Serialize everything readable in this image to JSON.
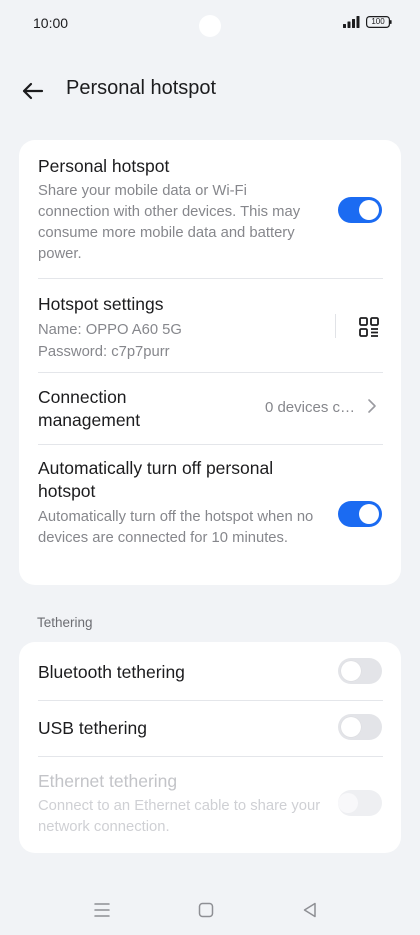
{
  "status_bar": {
    "time": "10:00",
    "battery": "100",
    "signal_icon": "signal-bars-icon",
    "battery_icon": "battery-icon"
  },
  "header": {
    "back_icon": "arrow-left-icon",
    "title": "Personal hotspot"
  },
  "colors": {
    "accent": "#1b6bf2",
    "background": "#f1f3f6",
    "card": "#ffffff"
  },
  "main_settings": {
    "personal_hotspot": {
      "title": "Personal hotspot",
      "description": "Share your mobile data or Wi-Fi connection with other devices. This may consume more mobile data and battery power.",
      "enabled": true
    },
    "hotspot_settings": {
      "title": "Hotspot settings",
      "name_line": "Name: OPPO A60 5G",
      "password_line": "Password: c7p7purr",
      "qr_icon": "qr-code-icon"
    },
    "connection_management": {
      "title": "Connection management",
      "value": "0 devices c…",
      "chevron_icon": "chevron-right-icon"
    },
    "auto_turn_off": {
      "title": "Automatically turn off personal hotspot",
      "description": "Automatically turn off the hotspot when no devices are connected for 10 minutes.",
      "enabled": true
    }
  },
  "tethering": {
    "section_label": "Tethering",
    "bluetooth": {
      "title": "Bluetooth tethering",
      "enabled": false
    },
    "usb": {
      "title": "USB tethering",
      "enabled": false
    },
    "ethernet": {
      "title": "Ethernet tethering",
      "description": "Connect to an Ethernet cable to share your network connection.",
      "enabled": false,
      "disabled": true
    }
  },
  "nav_bar": {
    "menu_icon": "menu-icon",
    "home_icon": "home-square-icon",
    "back_icon": "back-triangle-icon"
  }
}
